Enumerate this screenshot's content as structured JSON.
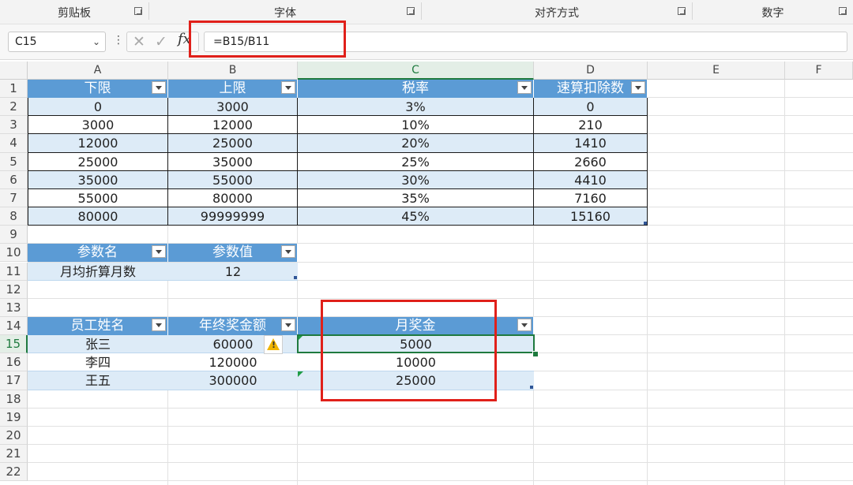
{
  "ribbon": {
    "groups": [
      {
        "label": "剪贴板"
      },
      {
        "label": "字体"
      },
      {
        "label": "对齐方式"
      },
      {
        "label": "数字"
      }
    ]
  },
  "formula_bar": {
    "name_box": "C15",
    "function_icon": "fx",
    "formula": "=B15/B11"
  },
  "icons": {
    "name_dropdown": "chevron-down-icon",
    "more": "kebab-icon",
    "cancel": "close-icon",
    "enter": "check-icon",
    "function": "fx-icon",
    "dialog_launcher": "dialog-launcher-icon",
    "filter": "filter-dropdown-icon",
    "error_indicator": "warning-icon"
  },
  "colors": {
    "header_fill": "#5b9bd5",
    "band_fill": "#ddebf7",
    "annotation_red": "#e0201a",
    "selection_green": "#1f7a3f"
  },
  "sheet": {
    "columns": [
      "A",
      "B",
      "C",
      "D",
      "E",
      "F"
    ],
    "rows": [
      "1",
      "2",
      "3",
      "4",
      "5",
      "6",
      "7",
      "8",
      "9",
      "10",
      "11",
      "12",
      "13",
      "14",
      "15",
      "16",
      "17",
      "18",
      "19",
      "20",
      "21",
      "22"
    ],
    "active_cell": "C15",
    "tax_table": {
      "headers": [
        "下限",
        "上限",
        "税率",
        "速算扣除数"
      ],
      "rows": [
        [
          "0",
          "3000",
          "3%",
          "0"
        ],
        [
          "3000",
          "12000",
          "10%",
          "210"
        ],
        [
          "12000",
          "25000",
          "20%",
          "1410"
        ],
        [
          "25000",
          "35000",
          "25%",
          "2660"
        ],
        [
          "35000",
          "55000",
          "30%",
          "4410"
        ],
        [
          "55000",
          "80000",
          "35%",
          "7160"
        ],
        [
          "80000",
          "99999999",
          "45%",
          "15160"
        ]
      ]
    },
    "param_table": {
      "headers": [
        "参数名",
        "参数值"
      ],
      "rows": [
        [
          "月均折算月数",
          "12"
        ]
      ]
    },
    "bonus_table": {
      "headers": [
        "员工姓名",
        "年终奖金额",
        "月奖金"
      ],
      "rows": [
        [
          "张三",
          "60000",
          "5000"
        ],
        [
          "李四",
          "120000",
          "10000"
        ],
        [
          "王五",
          "300000",
          "25000"
        ]
      ]
    }
  }
}
